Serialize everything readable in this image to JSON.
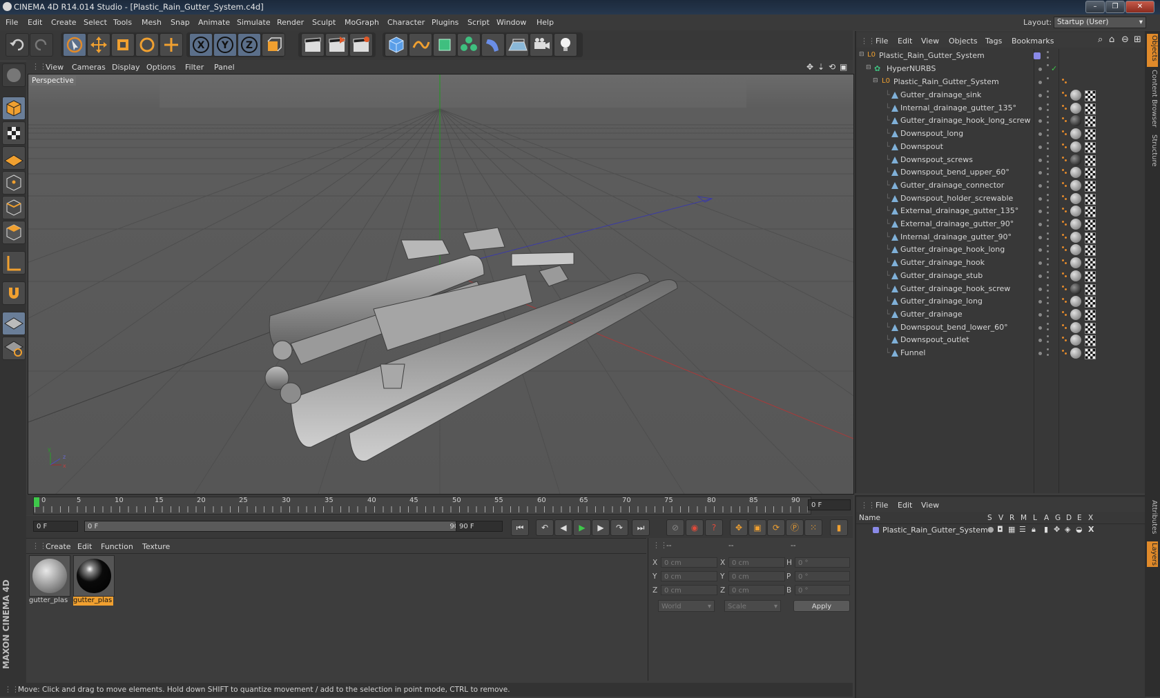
{
  "window": {
    "title": "CINEMA 4D R14.014 Studio - [Plastic_Rain_Gutter_System.c4d]",
    "minimize": "–",
    "maximize": "❐",
    "close": "✕"
  },
  "menu": [
    "File",
    "Edit",
    "Create",
    "Select",
    "Tools",
    "Mesh",
    "Snap",
    "Animate",
    "Simulate",
    "Render",
    "Sculpt",
    "MoGraph",
    "Character",
    "Plugins",
    "Script",
    "Window",
    "Help"
  ],
  "layout": {
    "label": "Layout:",
    "value": "Startup (User)"
  },
  "viewport": {
    "menu": [
      "View",
      "Cameras",
      "Display",
      "Options",
      "Filter",
      "Panel"
    ],
    "label": "Perspective"
  },
  "timeline": {
    "ticks": [
      "0",
      "5",
      "10",
      "15",
      "20",
      "25",
      "30",
      "35",
      "40",
      "45",
      "50",
      "55",
      "60",
      "65",
      "70",
      "75",
      "80",
      "85",
      "90"
    ],
    "current_frame": "0 F",
    "start_field": "0 F",
    "range_start": "0 F",
    "range_end": "90 F",
    "end_field": "90 F"
  },
  "materials": {
    "menu": [
      "Create",
      "Edit",
      "Function",
      "Texture"
    ],
    "items": [
      {
        "label": "gutter_plas",
        "selected": false
      },
      {
        "label": "gutter_plas",
        "selected": true
      }
    ]
  },
  "coords": {
    "headers": [
      "--",
      "--",
      "--"
    ],
    "rows": [
      {
        "l1": "X",
        "v1": "0 cm",
        "l2": "X",
        "v2": "0 cm",
        "l3": "H",
        "v3": "0 °"
      },
      {
        "l1": "Y",
        "v1": "0 cm",
        "l2": "Y",
        "v2": "0 cm",
        "l3": "P",
        "v3": "0 °"
      },
      {
        "l1": "Z",
        "v1": "0 cm",
        "l2": "Z",
        "v2": "0 cm",
        "l3": "B",
        "v3": "0 °"
      }
    ],
    "mode1": "World",
    "mode2": "Scale",
    "apply": "Apply"
  },
  "status": "Move: Click and drag to move elements. Hold down SHIFT to quantize movement / add to the selection in point mode, CTRL to remove.",
  "objects": {
    "menu": [
      "File",
      "Edit",
      "View",
      "Objects",
      "Tags",
      "Bookmarks"
    ],
    "root": "Plastic_Rain_Gutter_System",
    "hypernurbs": "HyperNURBS",
    "group": "Plastic_Rain_Gutter_System",
    "items": [
      {
        "name": "Gutter_drainage_sink",
        "dark": false
      },
      {
        "name": "Internal_drainage_gutter_135°",
        "dark": false
      },
      {
        "name": "Gutter_drainage_hook_long_screw",
        "dark": true
      },
      {
        "name": "Downspout_long",
        "dark": false
      },
      {
        "name": "Downspout",
        "dark": false
      },
      {
        "name": "Downspout_screws",
        "dark": true
      },
      {
        "name": "Downspout_bend_upper_60°",
        "dark": false
      },
      {
        "name": "Gutter_drainage_connector",
        "dark": false
      },
      {
        "name": "Downspout_holder_screwable",
        "dark": false
      },
      {
        "name": "External_drainage_gutter_135°",
        "dark": false
      },
      {
        "name": "External_drainage_gutter_90°",
        "dark": false
      },
      {
        "name": "Internal_drainage_gutter_90°",
        "dark": false
      },
      {
        "name": "Gutter_drainage_hook_long",
        "dark": false
      },
      {
        "name": "Gutter_drainage_hook",
        "dark": false
      },
      {
        "name": "Gutter_drainage_stub",
        "dark": false
      },
      {
        "name": "Gutter_drainage_hook_screw",
        "dark": true
      },
      {
        "name": "Gutter_drainage_long",
        "dark": false
      },
      {
        "name": "Gutter_drainage",
        "dark": false
      },
      {
        "name": "Downspout_bend_lower_60°",
        "dark": false
      },
      {
        "name": "Downspout_outlet",
        "dark": false
      },
      {
        "name": "Funnel",
        "dark": false
      }
    ]
  },
  "layers": {
    "menu": [
      "File",
      "Edit",
      "View"
    ],
    "columns": [
      "Name",
      "S",
      "V",
      "R",
      "M",
      "L",
      "A",
      "G",
      "D",
      "E",
      "X"
    ],
    "row": "Plastic_Rain_Gutter_System"
  },
  "side_tabs": [
    "Objects",
    "Content Browser",
    "Structure",
    "Attributes",
    "Layers"
  ],
  "brand": "MAXON CINEMA 4D"
}
